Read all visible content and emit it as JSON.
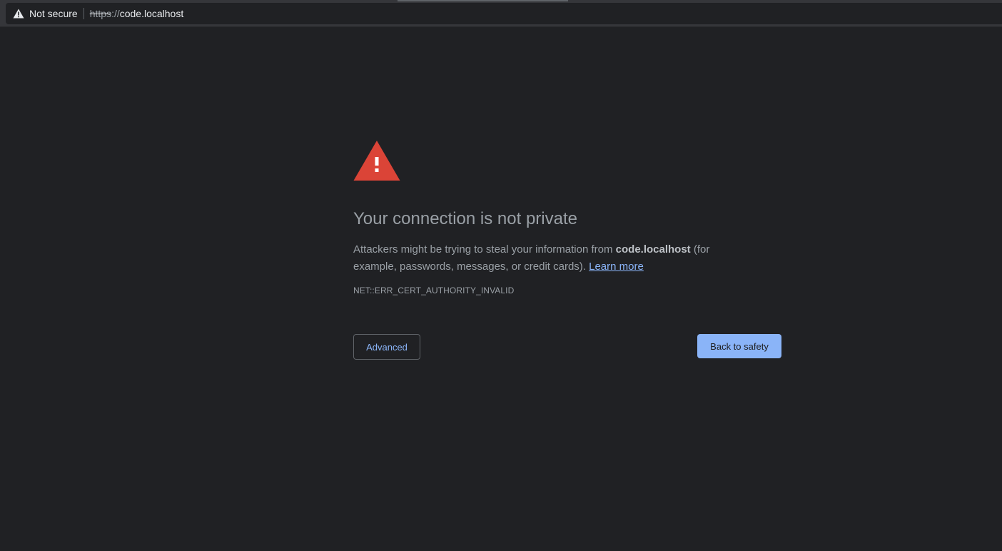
{
  "browser": {
    "security_label": "Not secure",
    "url_scheme": "https",
    "url_separator": "://",
    "url_host": "code.localhost",
    "icon": "warning-triangle-icon"
  },
  "interstitial": {
    "icon": "red-warning-triangle-icon",
    "heading": "Your connection is not private",
    "desc_before": "Attackers might be trying to steal your information from ",
    "desc_host": "code.localhost",
    "desc_after": " (for example, passwords, messages, or credit cards). ",
    "learn_more": "Learn more",
    "error_code": "NET::ERR_CERT_AUTHORITY_INVALID",
    "advanced_label": "Advanced",
    "back_label": "Back to safety"
  },
  "colors": {
    "background": "#202124",
    "toolbar": "#35363a",
    "text_secondary": "#9aa0a6",
    "link": "#8ab4f8",
    "warning_red": "#db4437"
  }
}
